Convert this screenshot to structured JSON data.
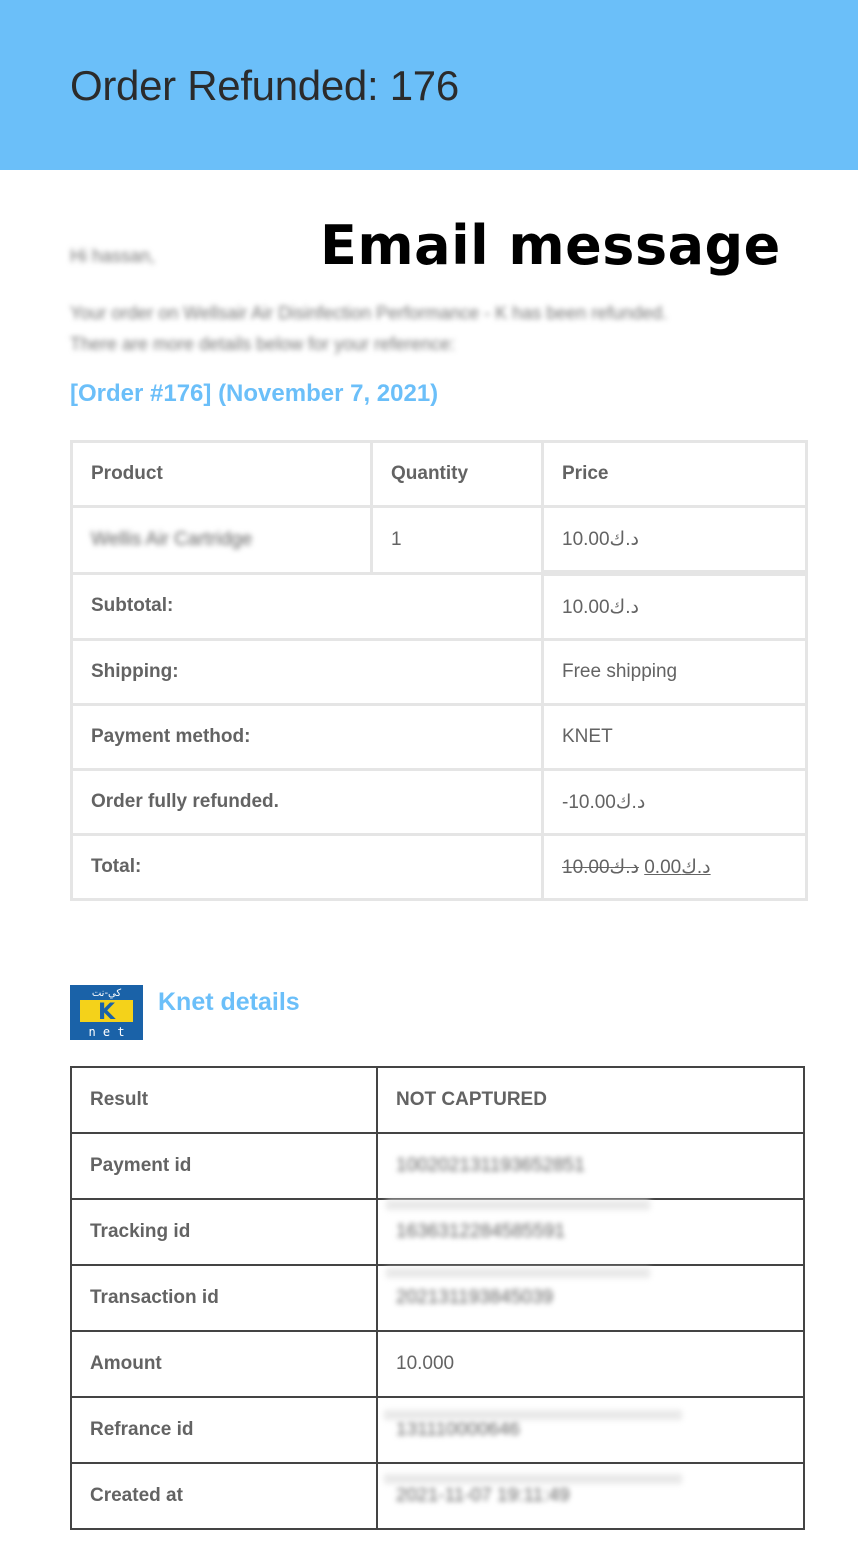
{
  "header": {
    "title": "Order Refunded: 176"
  },
  "overlay_label": "Email message",
  "greeting": "Hi hassan,",
  "intro": {
    "line1": "Your order on Wellsair Air Disinfection Performance - K has been refunded.",
    "line2": "There are more details below for your reference:"
  },
  "order": {
    "heading": "[Order #176] (November 7, 2021)",
    "columns": [
      "Product",
      "Quantity",
      "Price"
    ],
    "items": [
      {
        "product": "Wellis Air Cartridge",
        "quantity": "1",
        "price": "د.ك10.00"
      }
    ],
    "totals": [
      {
        "label": "Subtotal:",
        "value": "د.ك10.00"
      },
      {
        "label": "Shipping:",
        "value": "Free shipping"
      },
      {
        "label": "Payment method:",
        "value": "KNET"
      },
      {
        "label": "Order fully refunded.",
        "value": "-د.ك10.00"
      }
    ],
    "total": {
      "label": "Total:",
      "old_value": "د.ك10.00",
      "new_value": "د.ك0.00"
    }
  },
  "knet": {
    "logo_text_top": "كي-نت",
    "logo_letter": "K",
    "logo_text_bottom": "n e t",
    "heading": "Knet details",
    "rows": [
      {
        "label": "Result",
        "value": "NOT CAPTURED",
        "status_color": "#e8260c"
      },
      {
        "label": "Payment id",
        "value": "100202131193652851"
      },
      {
        "label": "Tracking id",
        "value": "1636312284585591"
      },
      {
        "label": "Transaction id",
        "value": "202131193845039"
      },
      {
        "label": "Amount",
        "value": "10.000"
      },
      {
        "label": "Refrance id",
        "value": "131110000646"
      },
      {
        "label": "Created at",
        "value": "2021-11-07 19:11:49"
      }
    ]
  },
  "colors": {
    "header_bg": "#6bbff9",
    "accent": "#6bbff9",
    "alert": "#e8260c",
    "logo_blue": "#1a62a8",
    "logo_yellow": "#f4d21a"
  }
}
